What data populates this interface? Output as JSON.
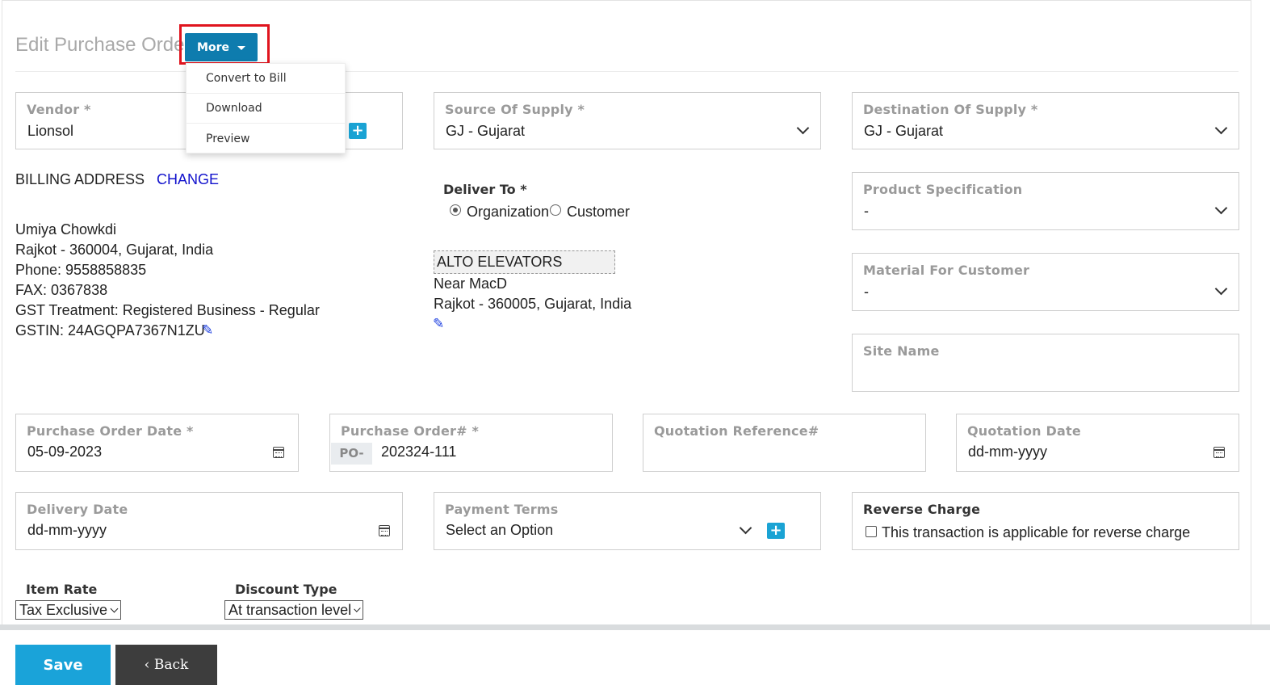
{
  "header": {
    "title": "Edit Purchase Order",
    "more_label": "More"
  },
  "more_menu": {
    "items": [
      "Convert to Bill",
      "Download",
      "Preview"
    ]
  },
  "vendor": {
    "label": "Vendor *",
    "value": "Lionsol"
  },
  "source_of_supply": {
    "label": "Source Of Supply *",
    "value": "GJ - Gujarat"
  },
  "destination_of_supply": {
    "label": "Destination Of Supply *",
    "value": "GJ - Gujarat"
  },
  "billing": {
    "heading": "BILLING ADDRESS",
    "change_label": "CHANGE",
    "lines": [
      "Umiya Chowkdi",
      "Rajkot - 360004, Gujarat, India",
      "Phone: 9558858835",
      "FAX: 0367838",
      "GST Treatment: Registered Business - Regular",
      "GSTIN: 24AGQPA7367N1ZU"
    ]
  },
  "deliver_to": {
    "label": "Deliver To *",
    "options": [
      "Organization",
      "Customer"
    ],
    "selected": "Organization",
    "address_name": "ALTO ELEVATORS",
    "address_lines": [
      "Near MacD",
      "Rajkot - 360005, Gujarat, India"
    ]
  },
  "product_specification": {
    "label": "Product Specification",
    "value": "-"
  },
  "material_for_customer": {
    "label": "Material For Customer",
    "value": "-"
  },
  "site_name": {
    "label": "Site Name",
    "value": ""
  },
  "purchase_order_date": {
    "label": "Purchase Order Date *",
    "value": "05-09-2023"
  },
  "purchase_order_number": {
    "label": "Purchase Order# *",
    "prefix": "PO-",
    "value": "202324-111"
  },
  "quotation_reference": {
    "label": "Quotation Reference#",
    "value": ""
  },
  "quotation_date": {
    "label": "Quotation Date",
    "value": "dd-mm-yyyy"
  },
  "delivery_date": {
    "label": "Delivery Date",
    "value": "dd-mm-yyyy"
  },
  "payment_terms": {
    "label": "Payment Terms",
    "value": "Select an Option"
  },
  "reverse_charge": {
    "label": "Reverse Charge",
    "checkbox_label": "This transaction is applicable for reverse charge",
    "checked": false
  },
  "item_rate": {
    "label": "Item Rate",
    "value": "Tax Exclusive"
  },
  "discount_type": {
    "label": "Discount Type",
    "value": "At transaction level"
  },
  "footer": {
    "save_label": "Save",
    "back_label": "‹ Back"
  },
  "colors": {
    "primary": "#0e7cae",
    "save": "#1aa3d9",
    "back": "#3d3d3d",
    "highlight": "#e0141e",
    "link": "#1111cc"
  }
}
